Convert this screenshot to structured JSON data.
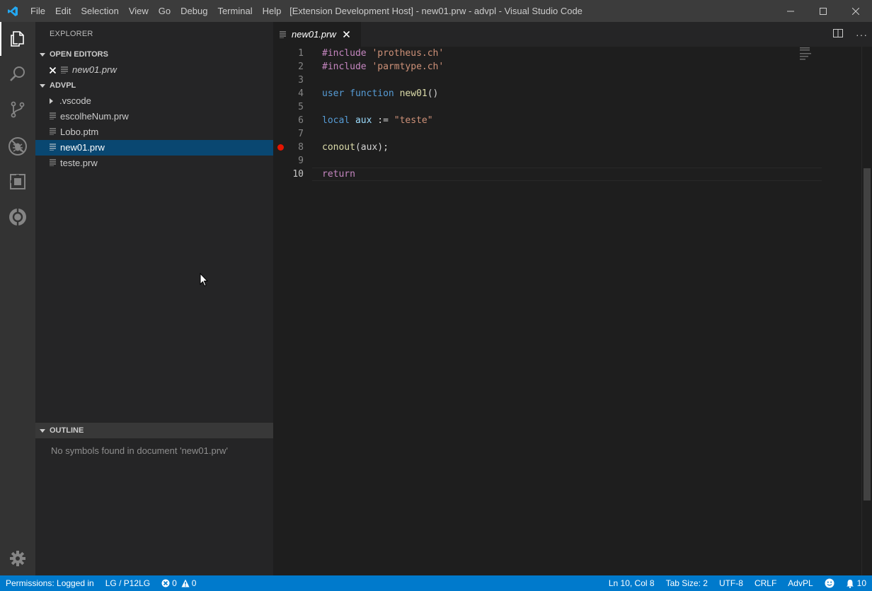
{
  "app": {
    "menu": [
      "File",
      "Edit",
      "Selection",
      "View",
      "Go",
      "Debug",
      "Terminal",
      "Help"
    ],
    "window_title": "[Extension Development Host] - new01.prw - advpl - Visual Studio Code"
  },
  "activity_bar": {
    "items": [
      "explorer-icon",
      "search-icon",
      "source-control-icon",
      "debug-icon",
      "extensions-icon",
      "sync-icon"
    ],
    "manage": "gear-icon"
  },
  "sidebar": {
    "title": "EXPLORER",
    "open_editors": {
      "header": "OPEN EDITORS",
      "items": [
        {
          "label": "new01.prw"
        }
      ]
    },
    "folder": {
      "header": "ADVPL",
      "items": [
        {
          "label": ".vscode",
          "type": "folder"
        },
        {
          "label": "escolheNum.prw",
          "type": "file"
        },
        {
          "label": "Lobo.ptm",
          "type": "file"
        },
        {
          "label": "new01.prw",
          "type": "file",
          "selected": true
        },
        {
          "label": "teste.prw",
          "type": "file"
        }
      ]
    },
    "outline": {
      "header": "OUTLINE",
      "message": "No symbols found in document 'new01.prw'"
    }
  },
  "editor": {
    "tab_label": "new01.prw",
    "line_numbers": [
      "1",
      "2",
      "3",
      "4",
      "5",
      "6",
      "7",
      "8",
      "9",
      "10"
    ],
    "breakpoint_line": 8,
    "current_line": 10,
    "code": {
      "l1_kw": "#include",
      "l1_str": "'protheus.ch'",
      "l2_kw": "#include",
      "l2_str": "'parmtype.ch'",
      "l4_a": "user",
      "l4_b": "function",
      "l4_c": "new01",
      "l4_d": "()",
      "l6_a": "local",
      "l6_b": "aux",
      "l6_c": ":=",
      "l6_d": "\"teste\"",
      "l8_a": "conout",
      "l8_b": "(aux);",
      "l10_a": "return"
    }
  },
  "status_bar": {
    "permissions": "Permissions: Logged in",
    "environment": "LG / P12LG",
    "errors": "0",
    "warnings": "0",
    "position": "Ln 10, Col 8",
    "tab_size": "Tab Size: 2",
    "encoding": "UTF-8",
    "eol": "CRLF",
    "language": "AdvPL",
    "notifications": "10"
  },
  "colors": {
    "accent": "#007acc",
    "selection": "#094771",
    "breakpoint": "#e51400"
  }
}
